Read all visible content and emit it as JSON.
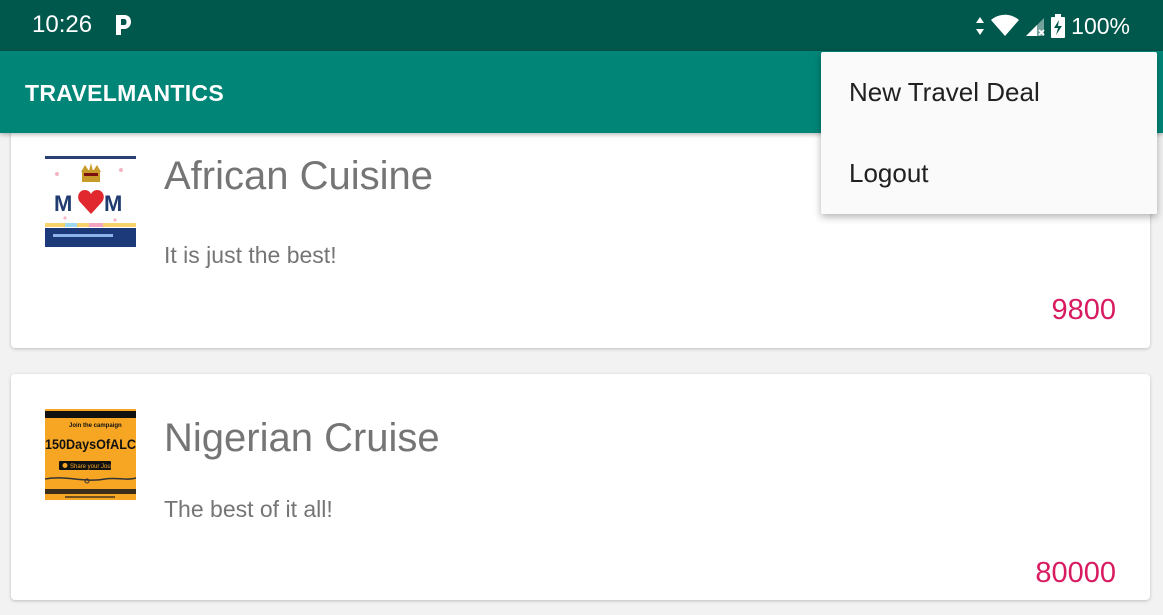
{
  "status_bar": {
    "time": "10:26",
    "battery_percent": "100%",
    "icons": [
      "parking-notification-icon",
      "data-arrows-icon",
      "wifi-icon",
      "cell-signal-icon",
      "battery-charging-icon"
    ]
  },
  "app_bar": {
    "title": "TRAVELMANTICS",
    "color": "#008577"
  },
  "overflow_menu": {
    "items": [
      {
        "label": "New Travel Deal"
      },
      {
        "label": "Logout"
      }
    ]
  },
  "deals": [
    {
      "title": "African Cuisine",
      "description": "It is just the best!",
      "price": "9800",
      "thumbnail_text": "MOM"
    },
    {
      "title": "Nigerian Cruise",
      "description": "The best of it all!",
      "price": "80000",
      "thumbnail_text": "150DaysOfALC",
      "thumbnail_header": "Join the campaign",
      "thumbnail_subtext": "Share your Journey"
    }
  ],
  "colors": {
    "status_bar": "#00574b",
    "accent_price": "#d81b60",
    "text_secondary": "#757575"
  }
}
